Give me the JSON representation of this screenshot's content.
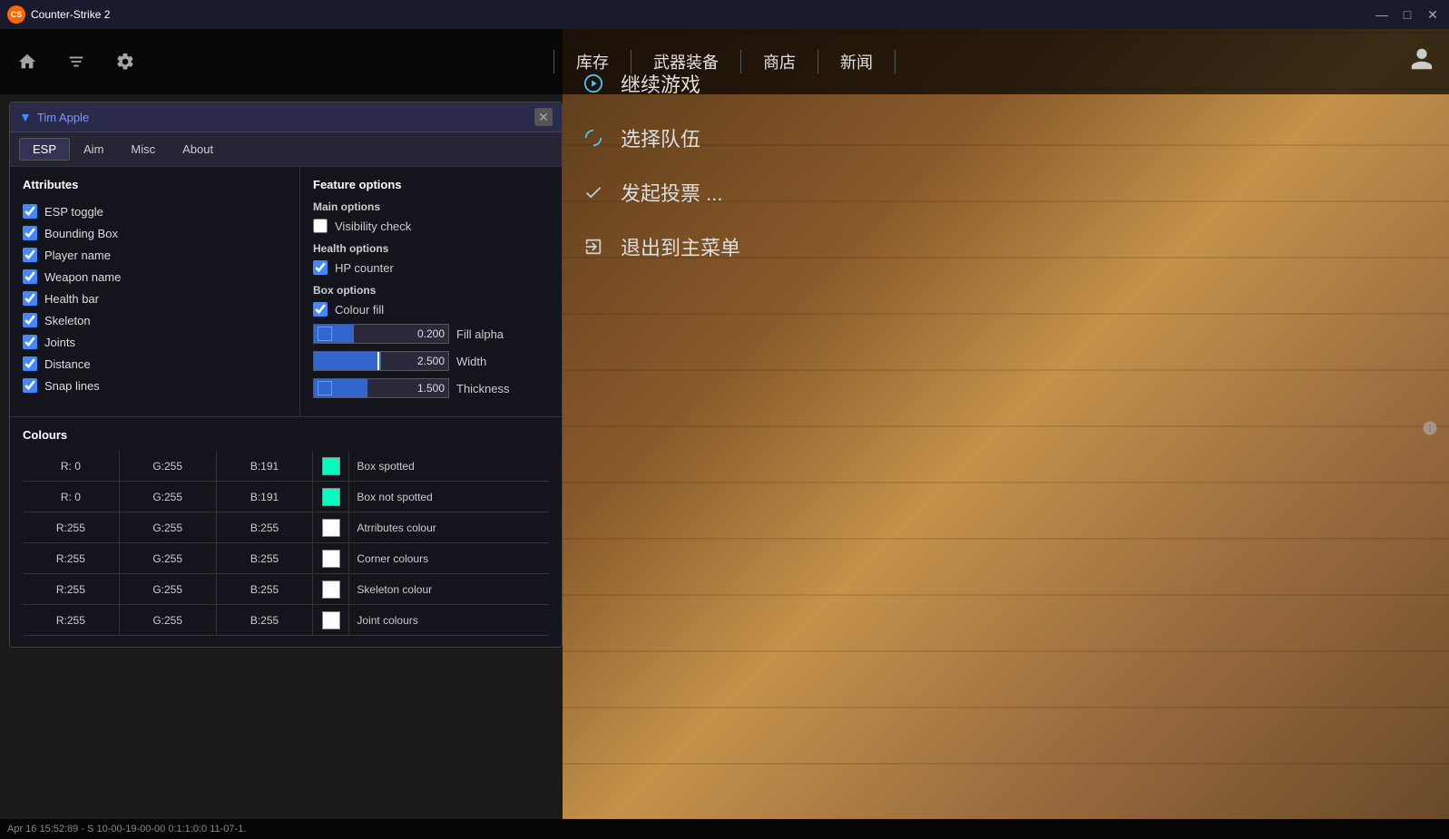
{
  "titleBar": {
    "title": "Counter-Strike 2",
    "iconText": "CS",
    "minimizeLabel": "—",
    "maximizeLabel": "□",
    "closeLabel": "✕"
  },
  "gameTopBar": {
    "navLinks": [
      "库存",
      "武器装备",
      "商店",
      "新闻"
    ]
  },
  "gameMenu": {
    "items": [
      {
        "icon": "▶",
        "text": "继续游戏",
        "type": "continue"
      },
      {
        "icon": "↺",
        "text": "选择队伍",
        "type": "team"
      },
      {
        "icon": "✓",
        "text": "发起投票 ...",
        "type": "vote"
      },
      {
        "icon": "⎋",
        "text": "退出到主菜单",
        "type": "exit"
      }
    ]
  },
  "hackPanel": {
    "title": "Tim Apple",
    "tabs": [
      "ESP",
      "Aim",
      "Misc",
      "About"
    ],
    "activeTab": "ESP",
    "attributes": {
      "sectionTitle": "Attributes",
      "items": [
        {
          "label": "ESP toggle",
          "checked": true
        },
        {
          "label": "Bounding Box",
          "checked": true
        },
        {
          "label": "Player name",
          "checked": true
        },
        {
          "label": "Weapon name",
          "checked": true
        },
        {
          "label": "Health bar",
          "checked": true
        },
        {
          "label": "Skeleton",
          "checked": true
        },
        {
          "label": "Joints",
          "checked": true
        },
        {
          "label": "Distance",
          "checked": true
        },
        {
          "label": "Snap lines",
          "checked": true
        }
      ]
    },
    "featureOptions": {
      "sectionTitle": "Feature options",
      "mainOptions": {
        "title": "Main options",
        "visibilityCheck": {
          "label": "Visibility check",
          "checked": false
        }
      },
      "healthOptions": {
        "title": "Health options",
        "hpCounter": {
          "label": "HP counter",
          "checked": true
        }
      },
      "boxOptions": {
        "title": "Box options",
        "colourFill": {
          "label": "Colour fill",
          "checked": true
        },
        "fillAlpha": {
          "value": "0.200",
          "label": "Fill alpha",
          "fillPercent": 30
        },
        "width": {
          "value": "2.500",
          "label": "Width",
          "fillPercent": 50
        },
        "thickness": {
          "value": "1.500",
          "label": "Thickness",
          "fillPercent": 40
        }
      }
    },
    "colours": {
      "sectionTitle": "Colours",
      "rows": [
        {
          "r": "R: 0",
          "g": "G:255",
          "b": "B:191",
          "swatchColor": "#00ffbf",
          "name": "Box spotted"
        },
        {
          "r": "R: 0",
          "g": "G:255",
          "b": "B:191",
          "swatchColor": "#00ffbf",
          "name": "Box not spotted"
        },
        {
          "r": "R:255",
          "g": "G:255",
          "b": "B:255",
          "swatchColor": "#ffffff",
          "name": "Atrributes colour"
        },
        {
          "r": "R:255",
          "g": "G:255",
          "b": "B:255",
          "swatchColor": "#ffffff",
          "name": "Corner colours"
        },
        {
          "r": "R:255",
          "g": "G:255",
          "b": "B:255",
          "swatchColor": "#ffffff",
          "name": "Skeleton colour"
        },
        {
          "r": "R:255",
          "g": "G:255",
          "b": "B:255",
          "swatchColor": "#ffffff",
          "name": "Joint colours"
        }
      ]
    }
  },
  "statusBar": {
    "text": "Apr 16 15:52:89 - S 10-00-19-00-00 0:1:1:0:0 11-07-1."
  }
}
